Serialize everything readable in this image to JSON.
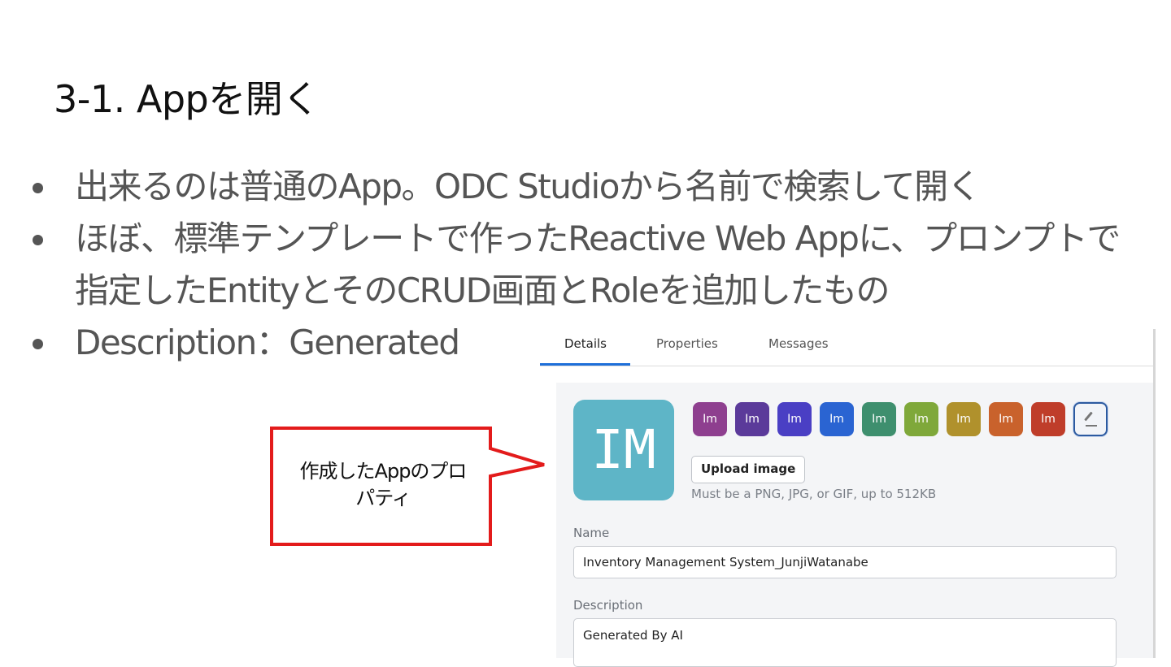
{
  "slide": {
    "title": "3-1. Appを開く",
    "bullets": [
      {
        "text": "出来るのは普通のApp。ODC Studioから名前で検索して開く"
      },
      {
        "text": "ほぼ、標準テンプレートで作ったReactive Web Appに、プロンプトで",
        "text2": "指定したEntityとそのCRUD画面とRoleを追加したもの"
      },
      {
        "text": "Description：Generated"
      }
    ]
  },
  "callout": {
    "line1": "作成したAppのプロ",
    "line2": "パティ"
  },
  "panel": {
    "tabs": [
      {
        "label": "Details",
        "active": true
      },
      {
        "label": "Properties",
        "active": false
      },
      {
        "label": "Messages",
        "active": false
      }
    ],
    "app_icon": {
      "initials": "IM",
      "color": "#5eb5c7"
    },
    "swatches": [
      {
        "label": "Im",
        "color": "#8e3f8f"
      },
      {
        "label": "Im",
        "color": "#5b3a9a"
      },
      {
        "label": "Im",
        "color": "#4a3fc4"
      },
      {
        "label": "Im",
        "color": "#2a64d2"
      },
      {
        "label": "Im",
        "color": "#3e8f6e"
      },
      {
        "label": "Im",
        "color": "#7fa83a"
      },
      {
        "label": "Im",
        "color": "#b0912c"
      },
      {
        "label": "Im",
        "color": "#c9622c"
      },
      {
        "label": "Im",
        "color": "#bf3d2a"
      }
    ],
    "picker_icon": "eyedropper-icon",
    "upload_button": "Upload image",
    "upload_hint": "Must be a PNG, JPG, or GIF, up to 512KB",
    "name": {
      "label": "Name",
      "value": "Inventory Management System_JunjiWatanabe"
    },
    "description": {
      "label": "Description",
      "value": "Generated By AI"
    }
  }
}
